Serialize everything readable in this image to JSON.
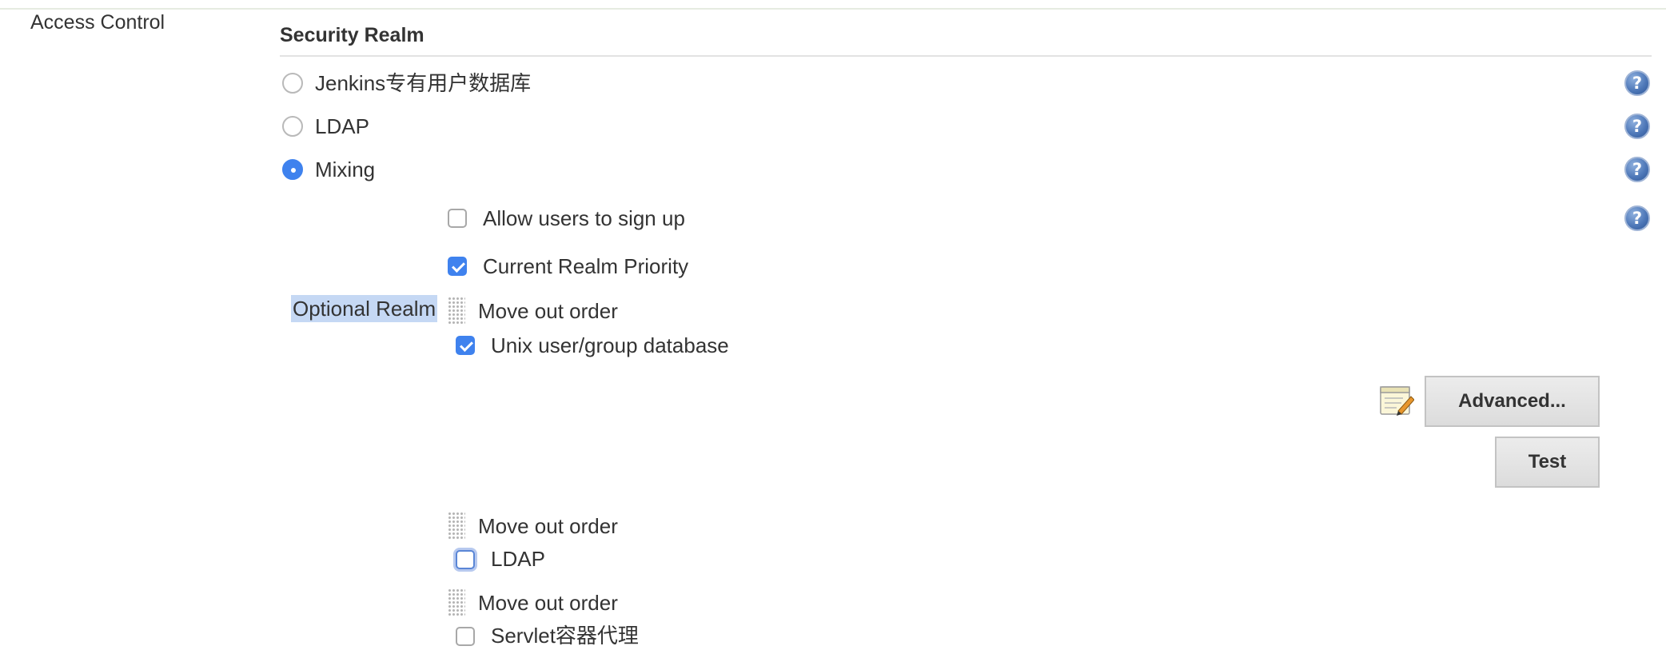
{
  "section": {
    "label": "Access Control"
  },
  "security_realm": {
    "heading": "Security Realm",
    "options": [
      {
        "label": "Jenkins专有用户数据库",
        "selected": false,
        "help_icon": "help-icon"
      },
      {
        "label": "LDAP",
        "selected": false,
        "help_icon": "help-icon"
      },
      {
        "label": "Mixing",
        "selected": true,
        "help_icon": "help-icon"
      }
    ]
  },
  "mixing": {
    "allow_signup": {
      "label": "Allow users to sign up",
      "checked": false,
      "help_icon": "help-icon"
    },
    "current_realm_priority": {
      "label": "Current Realm Priority",
      "checked": true
    },
    "optional_realm_label": "Optional Realm",
    "realms": [
      {
        "move_label": "Move out order",
        "label": "Unix user/group database",
        "checked": true
      },
      {
        "move_label": "Move out order",
        "label": "LDAP",
        "checked": false,
        "focused": true
      },
      {
        "move_label": "Move out order",
        "label": "Servlet容器代理",
        "checked": false
      }
    ],
    "advanced_button": "Advanced...",
    "test_button": "Test"
  },
  "colors": {
    "accent": "#3f82ee",
    "help": "#4f79b9",
    "button_bg": "#e0e0e0"
  }
}
